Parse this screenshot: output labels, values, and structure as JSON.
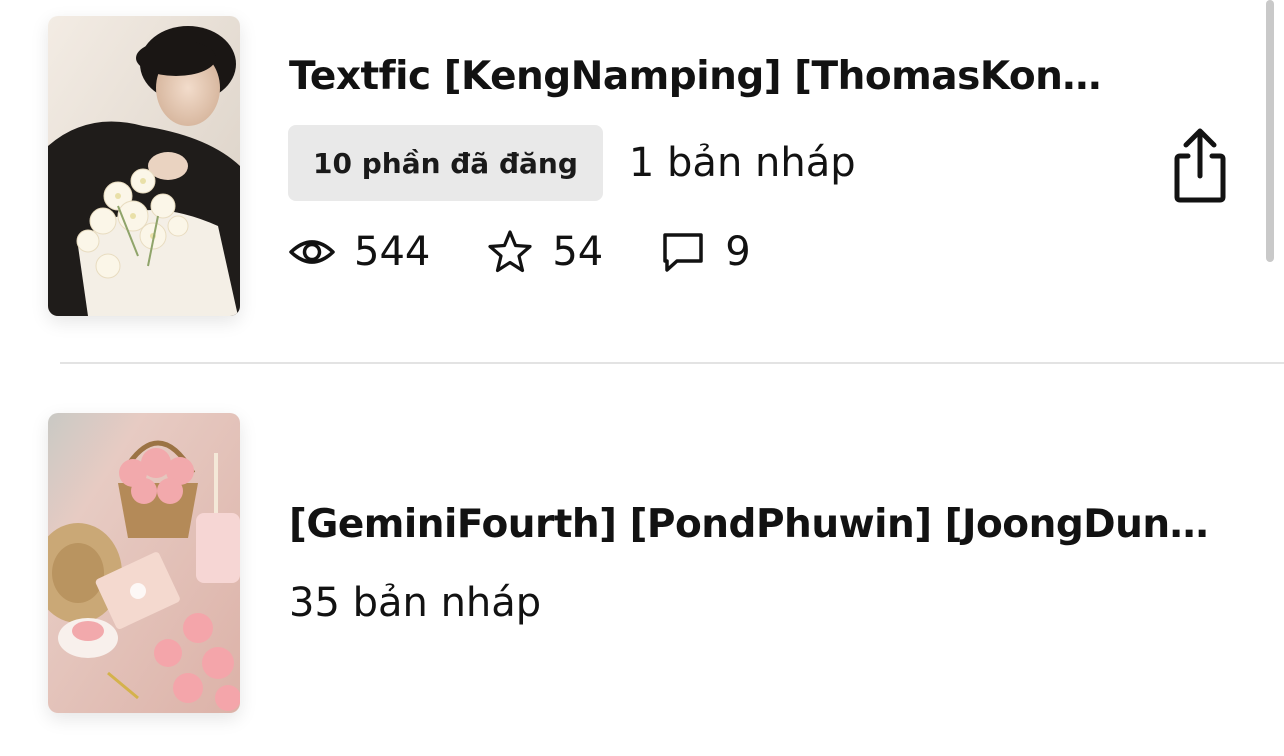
{
  "stories": [
    {
      "title": "Textfic [KengNamping] [ThomasKon…",
      "published_label": "10 phần đã đăng",
      "draft_label": "1 bản nháp",
      "stats": {
        "views": "544",
        "votes": "54",
        "comments": "9"
      },
      "icons": {
        "views": "eye-icon",
        "votes": "star-icon",
        "comments": "comment-icon",
        "share": "share-icon"
      }
    },
    {
      "title": "[GeminiFourth] [PondPhuwin] [JoongDun…",
      "draft_label": "35 bản nháp"
    }
  ],
  "colors": {
    "badge_bg": "#e9e9e9",
    "text": "#121212",
    "divider": "#e3e3e3"
  }
}
